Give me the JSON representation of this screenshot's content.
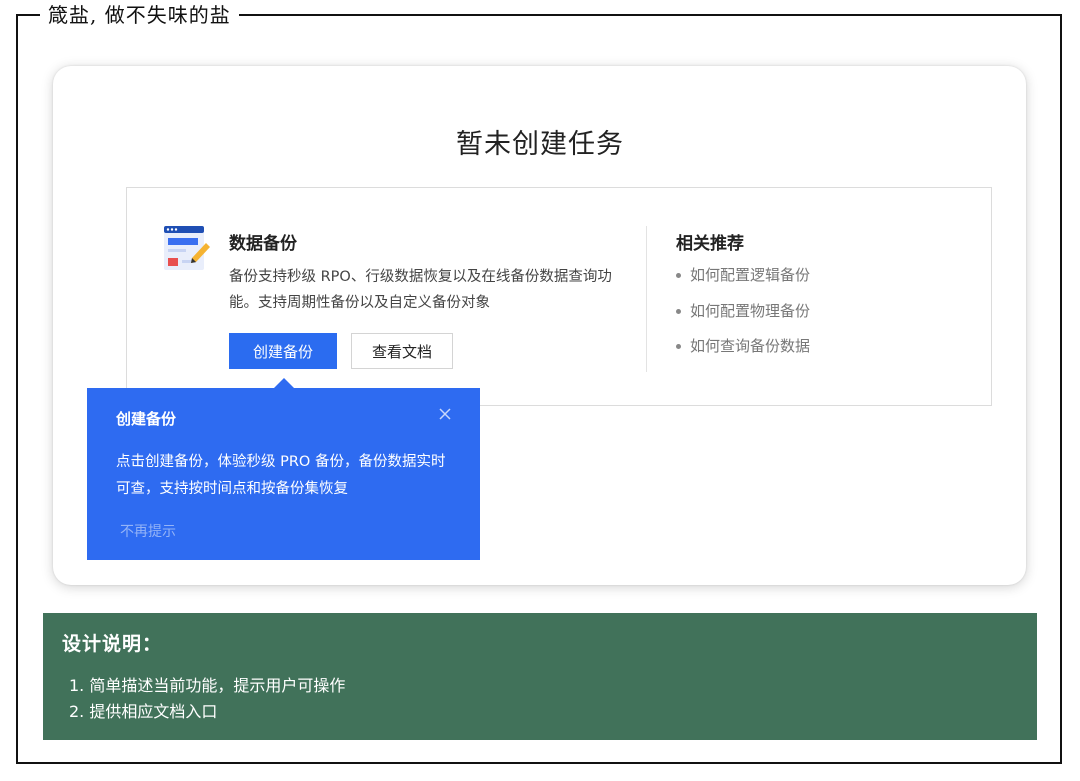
{
  "frame": {
    "caption": "箴盐, 做不失味的盐"
  },
  "empty_state": {
    "title": "暂未创建任务"
  },
  "feature": {
    "icon": "document-edit-icon",
    "title": "数据备份",
    "description": "备份支持秒级 RPO、行级数据恢复以及在线备份数据查询功能。支持周期性备份以及自定义备份对象",
    "primary_button": "创建备份",
    "secondary_button": "查看文档"
  },
  "recommend": {
    "title": "相关推荐",
    "items": [
      "如何配置逻辑备份",
      "如何配置物理备份",
      "如何查询备份数据"
    ]
  },
  "tooltip": {
    "title": "创建备份",
    "body": "点击创建备份，体验秒级 PRO 备份，备份数据实时可查，支持按时间点和按备份集恢复",
    "dismiss": "不再提示",
    "close_icon": "close-icon"
  },
  "notes": {
    "title": "设计说明：",
    "items": [
      "1. 简单描述当前功能，提示用户可操作",
      "2. 提供相应文档入口"
    ]
  },
  "colors": {
    "primary": "#2b6cf0",
    "tooltip_bg": "#2e6bf1",
    "notes_bg": "#41725a"
  }
}
